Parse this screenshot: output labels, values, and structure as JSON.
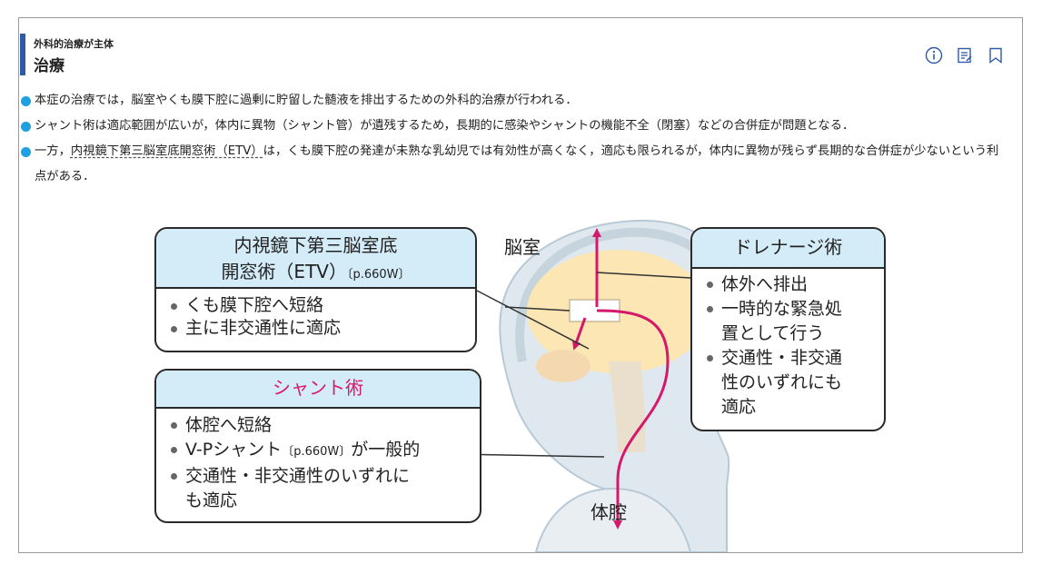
{
  "header": {
    "subtitle": "外科的治療が主体",
    "title": "治療",
    "icons": [
      "info-icon",
      "note-icon",
      "bookmark-icon"
    ]
  },
  "bullets": [
    {
      "text": "本症の治療では，脳室やくも膜下腔に過剰に貯留した髄液を排出するための外科的治療が行われる．"
    },
    {
      "text": "シャント術は適応範囲が広いが，体内に異物（シャント管）が遺残するため，長期的に感染やシャントの機能不全（閉塞）などの合併症が問題となる．"
    },
    {
      "pre": "一方，",
      "link": "内視鏡下第三脳室底開窓術（ETV）",
      "post": "は，くも膜下腔の発達が未熟な乳幼児では有効性が高くなく，適応も限られるが，体内に異物が残らず長期的な合併症が少ないという利点がある．"
    }
  ],
  "figure": {
    "etv_box": {
      "title_line1": "内視鏡下第三脳室底",
      "title_line2": "開窓術（ETV）",
      "ref": "〔p.660W〕",
      "items": [
        "くも膜下腔へ短絡",
        "主に非交通性に適応"
      ]
    },
    "shunt_box": {
      "title": "シャント術",
      "items": [
        "体腔へ短絡",
        "V-Pシャント",
        "が一般的",
        "交通性・非交通性のいずれに",
        "も適応"
      ],
      "ref": "〔p.660W〕"
    },
    "drain_box": {
      "title": "ドレナージ術",
      "items": [
        "体外へ排出",
        "一時的な緊急処",
        "置として行う",
        "交通性・非交通",
        "性のいずれにも",
        "適応"
      ]
    },
    "labels": {
      "ventricle": "脳室",
      "body_cavity": "体腔"
    },
    "colors": {
      "accent_pink": "#d6186b",
      "box_head": "#d4ebf8",
      "brain": "#fbe6b4",
      "head": "#dfe8ef",
      "bullet_blue": "#1fa0e3",
      "header_bar": "#2e5aa7"
    }
  }
}
